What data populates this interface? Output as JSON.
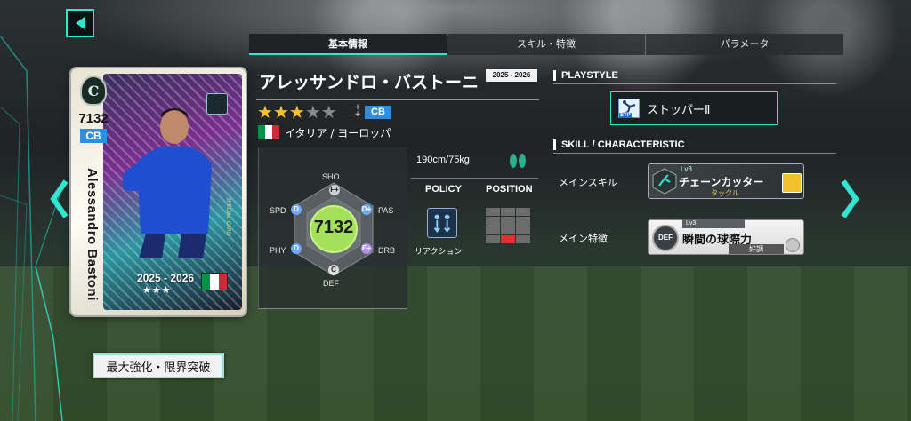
{
  "tabs": [
    {
      "label": "基本情報",
      "active": true
    },
    {
      "label": "スキル・特徴",
      "active": false
    },
    {
      "label": "パラメータ",
      "active": false
    }
  ],
  "player": {
    "name": "アレッサンドロ・バストーニ",
    "season_tag": "2025 - 2026",
    "stars_total": 5,
    "stars_filled": 3,
    "position": "CB",
    "nation": "イタリア / ヨーロッパ",
    "flag_colors": [
      "#009246",
      "#ffffff",
      "#ce2b37"
    ],
    "body": "190cm/75kg",
    "overall": "7132"
  },
  "card": {
    "rank_letter": "C",
    "number": "7132",
    "position": "CB",
    "name": "Alessandro Bastoni",
    "season": "2025 - 2026",
    "stars": "★★★",
    "special_text": "SPECIAL CARD"
  },
  "stats": [
    {
      "key": "SHO",
      "grade": "F+",
      "color": "#cfcfcf"
    },
    {
      "key": "PAS",
      "grade": "D+",
      "color": "#6fa8ff"
    },
    {
      "key": "DRB",
      "grade": "E+",
      "color": "#b48cff"
    },
    {
      "key": "DEF",
      "grade": "C",
      "color": "#dddddd"
    },
    {
      "key": "PHY",
      "grade": "D",
      "color": "#6fa8ff"
    },
    {
      "key": "SPD",
      "grade": "D",
      "color": "#6fa8ff"
    }
  ],
  "policy": {
    "head": "POLICY",
    "label": "リアクション"
  },
  "position_section": {
    "head": "POSITION"
  },
  "playstyle": {
    "head": "PLAYSTYLE",
    "icon_tag": "STP",
    "name": "ストッパーⅡ"
  },
  "skills": {
    "head": "SKILL / CHARACTERISTIC",
    "main_skill": {
      "label": "メインスキル",
      "lv": "Lv3",
      "name": "チェーンカッター",
      "sub": "タックル"
    },
    "main_trait": {
      "label": "メイン特徴",
      "lv": "Lv3",
      "name": "瞬間の球際力",
      "cond": "好調",
      "icon": "DEF"
    }
  },
  "limit_button": "最大強化・限界突破",
  "colors": {
    "accent": "#2ee6d2",
    "position_blue": "#2d8fe0",
    "star_gold": "#f3c12d"
  }
}
